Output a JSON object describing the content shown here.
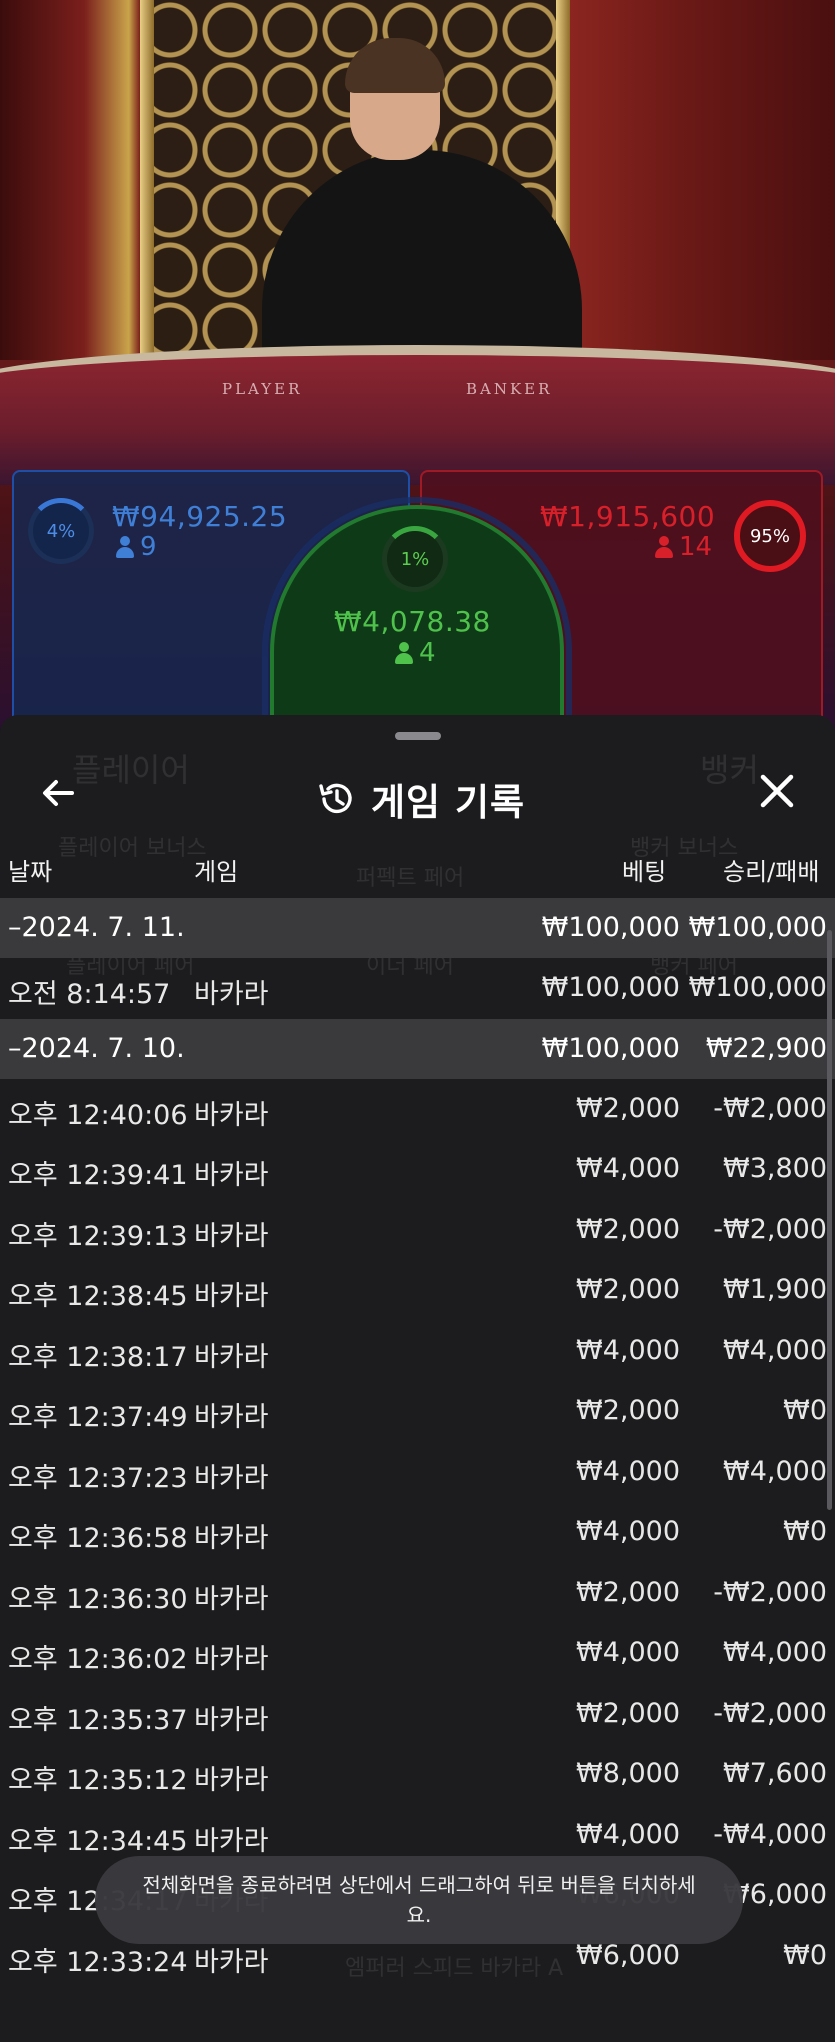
{
  "video": {
    "table_labels": {
      "player": "PLAYER",
      "banker": "BANKER"
    }
  },
  "bets": {
    "player": {
      "percent": "4%",
      "amount": "₩94,925.25",
      "players": "9",
      "color": "#3f7fd6"
    },
    "tie": {
      "percent": "1%",
      "amount": "₩4,078.38",
      "players": "4",
      "color": "#4fc24c"
    },
    "banker": {
      "percent": "95%",
      "amount": "₩1,915,600",
      "players": "14",
      "color": "#d8202a"
    }
  },
  "background_ghost": {
    "player": "플레이어",
    "banker": "뱅커",
    "player_bonus": "플레이어 보너스",
    "banker_bonus": "뱅커 보너스",
    "perfect_pair": "퍼펙트 페어",
    "either_pair": "이더 페어",
    "player_pair": "플레이어 페어",
    "banker_pair": "뱅커 페어",
    "footer_ghost": "엠퍼러 스피드 바카라 A"
  },
  "history": {
    "title": "게임 기록",
    "icons": {
      "back": "arrow-left-icon",
      "history": "history-clock-icon",
      "close": "close-x-icon"
    },
    "columns": {
      "date": "날짜",
      "game": "게임",
      "bet": "베팅",
      "result": "승리/패배"
    },
    "rows": [
      {
        "type": "date",
        "time": "–2024. 7. 11.",
        "game": "",
        "bet": "₩100,000",
        "result": "₩100,000"
      },
      {
        "type": "entry",
        "time": "오전 8:14:57",
        "game": "바카라",
        "bet": "₩100,000",
        "result": "₩100,000"
      },
      {
        "type": "date",
        "time": "–2024. 7. 10.",
        "game": "",
        "bet": "₩100,000",
        "result": "₩22,900"
      },
      {
        "type": "entry",
        "time": "오후 12:40:06",
        "game": "바카라",
        "bet": "₩2,000",
        "result": "-₩2,000"
      },
      {
        "type": "entry",
        "time": "오후 12:39:41",
        "game": "바카라",
        "bet": "₩4,000",
        "result": "₩3,800"
      },
      {
        "type": "entry",
        "time": "오후 12:39:13",
        "game": "바카라",
        "bet": "₩2,000",
        "result": "-₩2,000"
      },
      {
        "type": "entry",
        "time": "오후 12:38:45",
        "game": "바카라",
        "bet": "₩2,000",
        "result": "₩1,900"
      },
      {
        "type": "entry",
        "time": "오후 12:38:17",
        "game": "바카라",
        "bet": "₩4,000",
        "result": "₩4,000"
      },
      {
        "type": "entry",
        "time": "오후 12:37:49",
        "game": "바카라",
        "bet": "₩2,000",
        "result": "₩0"
      },
      {
        "type": "entry",
        "time": "오후 12:37:23",
        "game": "바카라",
        "bet": "₩4,000",
        "result": "₩4,000"
      },
      {
        "type": "entry",
        "time": "오후 12:36:58",
        "game": "바카라",
        "bet": "₩4,000",
        "result": "₩0"
      },
      {
        "type": "entry",
        "time": "오후 12:36:30",
        "game": "바카라",
        "bet": "₩2,000",
        "result": "-₩2,000"
      },
      {
        "type": "entry",
        "time": "오후 12:36:02",
        "game": "바카라",
        "bet": "₩4,000",
        "result": "₩4,000"
      },
      {
        "type": "entry",
        "time": "오후 12:35:37",
        "game": "바카라",
        "bet": "₩2,000",
        "result": "-₩2,000"
      },
      {
        "type": "entry",
        "time": "오후 12:35:12",
        "game": "바카라",
        "bet": "₩8,000",
        "result": "₩7,600"
      },
      {
        "type": "entry",
        "time": "오후 12:34:45",
        "game": "바카라",
        "bet": "₩4,000",
        "result": "-₩4,000"
      },
      {
        "type": "entry",
        "time": "오후 12:34:17",
        "game": "바카라",
        "bet": "₩6,000",
        "result": "₩6,000"
      },
      {
        "type": "entry",
        "time": "오후 12:33:24",
        "game": "바카라",
        "bet": "₩6,000",
        "result": "₩0"
      }
    ]
  },
  "toast": {
    "message": "전체화면을 종료하려면 상단에서 드래그하여 뒤로 버튼을 터치하세요."
  }
}
